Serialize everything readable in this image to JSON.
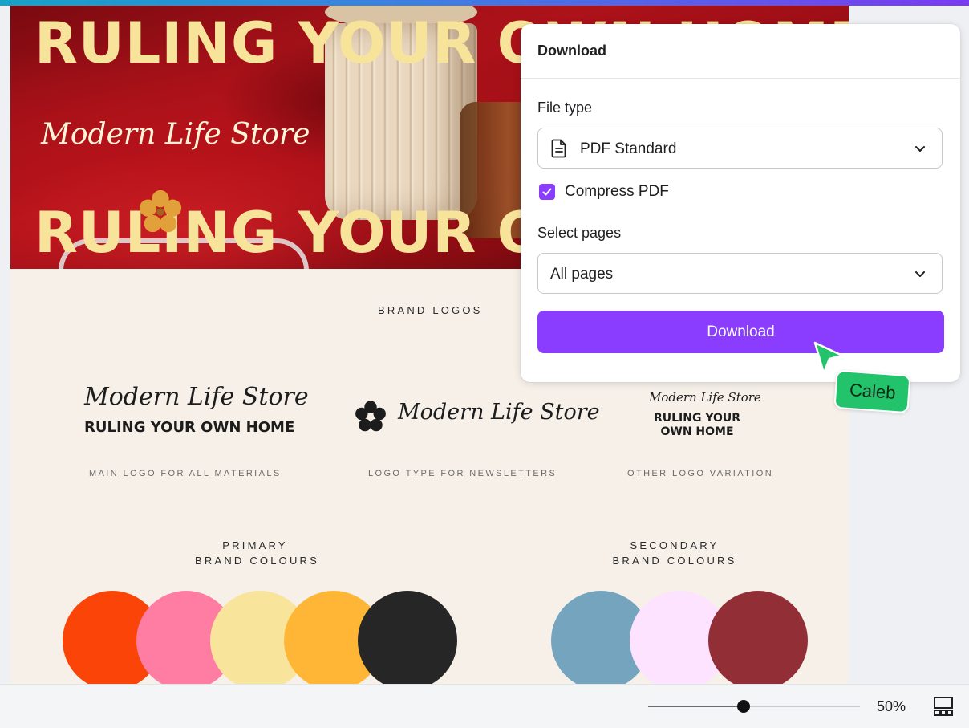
{
  "hero": {
    "headline_top": "RULING YOUR OWN HOME",
    "script_text": "Modern Life Store",
    "headline_bottom": "RULING YOUR OWN HOME"
  },
  "brand_logos": {
    "section_title": "BRAND LOGOS",
    "logos": [
      {
        "script": "Modern Life Store",
        "bold": "RULING YOUR OWN HOME",
        "caption": "MAIN LOGO FOR ALL MATERIALS"
      },
      {
        "script": "Modern Life Store",
        "caption": "LOGO TYPE FOR NEWSLETTERS"
      },
      {
        "script": "Modern Life Store",
        "bold_line1": "RULING YOUR",
        "bold_line2": "OWN HOME",
        "caption": "OTHER LOGO VARIATION"
      }
    ]
  },
  "colours": {
    "primary_title_line1": "PRIMARY",
    "primary_title_line2": "BRAND COLOURS",
    "secondary_title_line1": "SECONDARY",
    "secondary_title_line2": "BRAND COLOURS",
    "primary_swatches": [
      "#fb4407",
      "#ff7ca3",
      "#f8e59b",
      "#ffb636",
      "#262626"
    ],
    "secondary_swatches": [
      "#75a4bf",
      "#fde3ff",
      "#922e36"
    ]
  },
  "download_panel": {
    "title": "Download",
    "file_type_label": "File type",
    "file_type_value": "PDF Standard",
    "file_type_icon": "document-icon",
    "compress_label": "Compress PDF",
    "compress_checked": true,
    "select_pages_label": "Select pages",
    "select_pages_value": "All pages",
    "button_label": "Download",
    "accent_color": "#8b3dff"
  },
  "collaborator": {
    "name": "Caleb",
    "color": "#23c36b"
  },
  "footer": {
    "zoom_value": 50,
    "zoom_label": "50%",
    "pages_icon": "page-grid-icon"
  }
}
